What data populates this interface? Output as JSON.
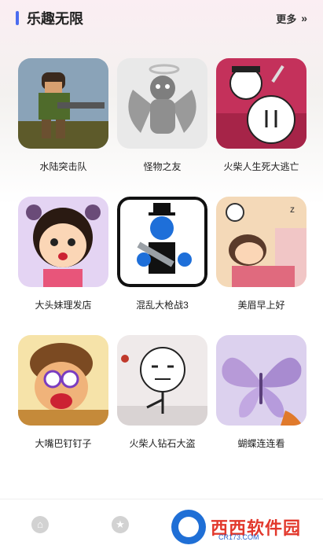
{
  "header": {
    "title": "乐趣无限",
    "more_label": "更多",
    "more_icon": "chevron-double-right-icon",
    "accent_color": "#4b6cf0"
  },
  "games": [
    {
      "name": "水陆突击队",
      "thumb": "soldier-with-gun"
    },
    {
      "name": "怪物之友",
      "thumb": "winged-angel-monster"
    },
    {
      "name": "火柴人生死大逃亡",
      "thumb": "stickman-escape"
    },
    {
      "name": "大头妹理发店",
      "thumb": "big-head-girl"
    },
    {
      "name": "混乱大枪战3",
      "thumb": "stickman-gunfight"
    },
    {
      "name": "美眉早上好",
      "thumb": "girl-in-bed-alarm"
    },
    {
      "name": "大嘴巴钉钉子",
      "thumb": "big-mouth-character"
    },
    {
      "name": "火柴人钻石大盗",
      "thumb": "stickman-thief"
    },
    {
      "name": "蝴蝶连连看",
      "thumb": "butterfly"
    }
  ],
  "tabbar": {
    "tabs": [
      {
        "icon": "home-icon"
      },
      {
        "icon": "star-icon"
      }
    ]
  },
  "watermark": {
    "main": "西西软件园",
    "sub": "CR173.COM"
  }
}
